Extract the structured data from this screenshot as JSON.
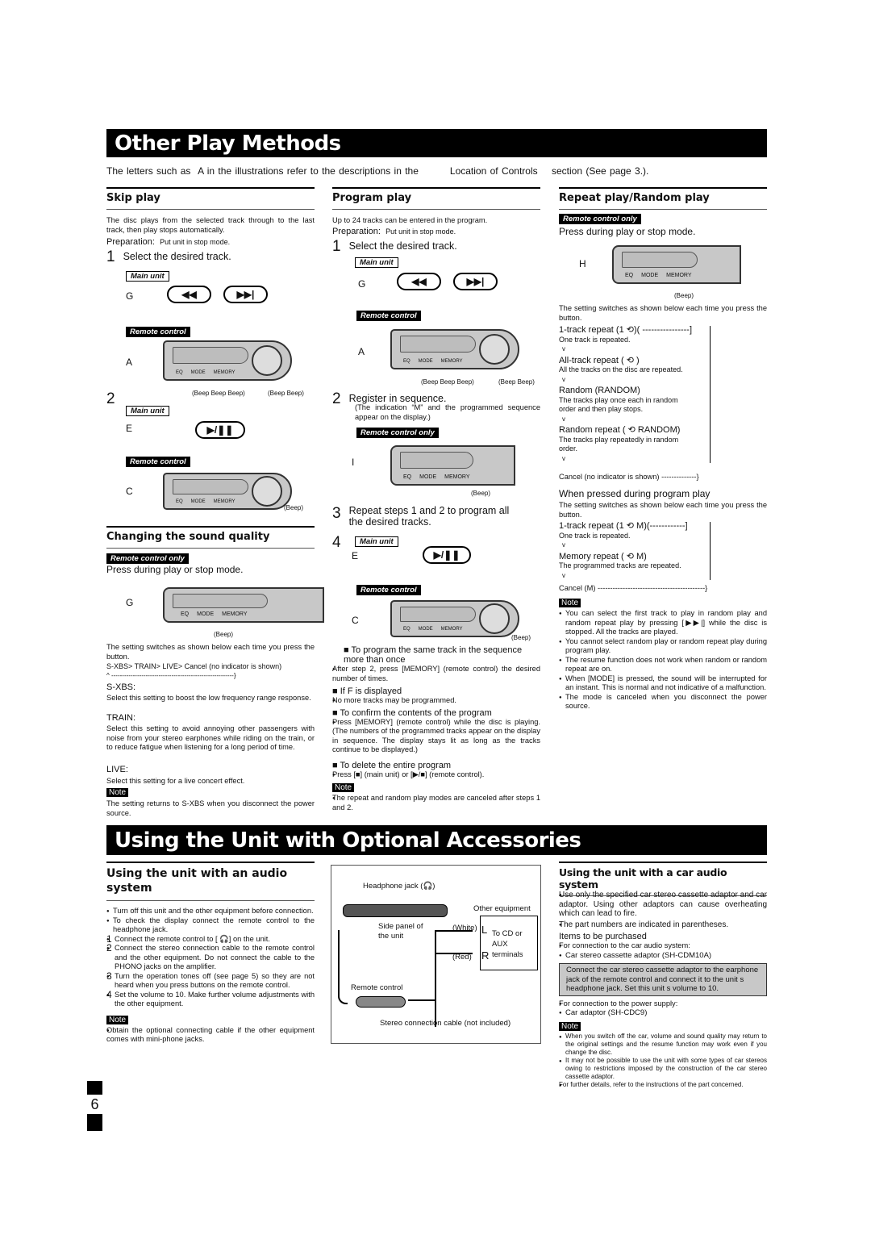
{
  "title1": "Other Play Methods",
  "intro": {
    "a": "The letters such as",
    "b": "A",
    "c": "in the illustrations refer to the descriptions in the",
    "d": "Location of Controls",
    "e": "section (See page 3.)."
  },
  "device_labels": [
    "EQ",
    "MODE",
    "MEMORY"
  ],
  "common": {
    "main_unit": "Main unit",
    "remote_control": "Remote control",
    "remote_only": "Remote control only",
    "beep": "(Beep)",
    "beep2": "(Beep Beep)",
    "beep3": "(Beep Beep Beep)",
    "note": "Note",
    "prev": "◀◀",
    "next": "▶▶|",
    "play": "▶/❚❚",
    "prep_label": "Preparation:",
    "prep": "Put unit in stop mode.",
    "press_during": "Press during play or stop mode."
  },
  "skip": {
    "heading": "Skip play",
    "desc": "The disc plays from the selected track through to the last track, then play stops automatically.",
    "step1": "Select the desired track.",
    "letters": [
      "G",
      "A",
      "E",
      "C"
    ]
  },
  "sound": {
    "heading": "Changing the sound quality",
    "letter": "G",
    "switch": "The setting switches as shown below each time you press the button.",
    "cycle": "S-XBS>  TRAIN>  LIVE>  Cancel (no indicator is shown)",
    "cycle_back": "^ ---------------------------------------------------------}",
    "sxbs": "S-XBS:",
    "sxbs_desc": "Select this setting to boost the low frequency range response.",
    "train": "TRAIN:",
    "train_desc": "Select this setting to avoid annoying other passengers with noise from your stereo earphones while riding on the train, or to reduce fatigue when listening for a long period of time.",
    "live": "LIVE:",
    "live_desc": "Select this setting for a live concert effect.",
    "note": "The setting returns to S-XBS when you disconnect the power source."
  },
  "program": {
    "heading": "Program play",
    "desc": "Up to 24 tracks can be entered in the program.",
    "step1": "Select the desired track.",
    "step2": "Register in sequence.",
    "step2_desc": "(The indication “M” and the programmed sequence appear on the display.)",
    "step3": "Repeat steps 1 and 2 to program all the desired tracks.",
    "letters": [
      "G",
      "A",
      "I",
      "E",
      "C"
    ],
    "tips": [
      {
        "title": "To program the same track in the sequence more than once",
        "text": "After step 2, press [MEMORY] (remote control) the desired number of times."
      },
      {
        "title": "If   F   is displayed",
        "text": "No more tracks may be programmed."
      },
      {
        "title": "To confirm the contents of the program",
        "text": "Press [MEMORY] (remote control) while the disc is playing. (The numbers of the programmed tracks appear on the display in sequence. The display stays lit as long as the tracks continue to be displayed.)"
      },
      {
        "title": "To delete the entire program",
        "text": "Press [■] (main unit) or [▶/■] (remote control)."
      }
    ],
    "note": "The repeat and random play modes are canceled after steps 1 and 2."
  },
  "repeat": {
    "heading": "Repeat play/Random play",
    "letter": "H",
    "switch": "The setting switches as shown below each time you press the button.",
    "flow": [
      {
        "mode": "1-track repeat (1 ⟲)( ----------------]",
        "desc": "One track is repeated."
      },
      {
        "mode": "All-track repeat ( ⟲ )",
        "desc": "All the tracks on the disc are repeated."
      },
      {
        "mode": "Random (RANDOM)",
        "desc": "The tracks play once each in random order and then play stops."
      },
      {
        "mode": "Random repeat ( ⟲ RANDOM)",
        "desc": "The tracks play repeatedly in random order."
      }
    ],
    "cancel": "Cancel (no indicator is shown) --------------}",
    "prog_heading": "When pressed during program play",
    "prog_flow": [
      {
        "mode": "1-track repeat (1 ⟲ M)(------------]",
        "desc": "One track is repeated."
      },
      {
        "mode": "Memory repeat ( ⟲ M)",
        "desc": "The programmed tracks are repeated."
      }
    ],
    "prog_cancel": "Cancel (M) -------------------------------------------}",
    "arrow": "v",
    "notes": [
      "You can select the first track to play in random play and random repeat play by pressing [▶▶|] while the disc is stopped. All the tracks are played.",
      "You cannot select random play or random repeat play during program play.",
      "The resume function does not work when random or random repeat are on.",
      "When [MODE] is pressed, the sound will be interrupted for an instant. This is normal and not indicative of a malfunction.",
      "The mode is canceled when you disconnect the power source."
    ]
  },
  "title2": "Using the Unit with Optional Accessories",
  "audio": {
    "heading": "Using the unit with an audio system",
    "bullets": [
      "Turn off this unit and the other equipment before connection.",
      "To check the display connect the remote control to the headphone jack."
    ],
    "steps": [
      {
        "n": "1",
        "t": "Connect the remote control to [ 🎧] on the unit."
      },
      {
        "n": "2",
        "t": "Connect the stereo connection cable to the remote control and the other equipment. Do not connect the cable to the PHONO jacks on the amplifier."
      },
      {
        "n": "3",
        "t": "Turn the operation tones off (see page 5) so they are not heard when you press buttons on the remote control."
      },
      {
        "n": "4",
        "t": "Set the volume to 10. Make further volume adjustments with the other equipment."
      }
    ],
    "note": "Obtain the optional connecting cable if the other equipment comes with mini-phone jacks."
  },
  "diagram": {
    "headphone": "Headphone jack (🎧)",
    "side_panel": "Side panel of the unit",
    "other": "Other equipment",
    "white": "(White)",
    "red": "(Red)",
    "L": "L",
    "R": "R",
    "to_cd": "To CD or AUX terminals",
    "remote": "Remote control",
    "cable": "Stereo connection cable (not included)"
  },
  "car": {
    "heading": "Using the unit with a car audio system",
    "desc": "Use only the specified car stereo cassette adaptor and car adaptor. Using other adaptors can cause overheating which can lead to fire.",
    "parts": "The part numbers are indicated in parentheses.",
    "items": "Items to be purchased",
    "for_car": "For connection to the car audio system:",
    "cassette": "Car stereo cassette adaptor (SH-CDM10A)",
    "box": "Connect the car stereo cassette adaptor to the earphone jack of the remote control and connect it to the unit s headphone jack. Set this unit s volume to 10.",
    "for_power": "For connection to the power supply:",
    "adaptor": "Car adaptor (SH-CDC9)",
    "notes": [
      "When you switch off the car, volume and sound quality may return to the original settings and the resume function may work even if you change the disc.",
      "It may not be possible to use the unit with some types of car stereos owing to restrictions imposed by the construction of the car stereo cassette adaptor."
    ],
    "further": "For further details, refer to the instructions of the part concerned."
  },
  "page_number": "6"
}
